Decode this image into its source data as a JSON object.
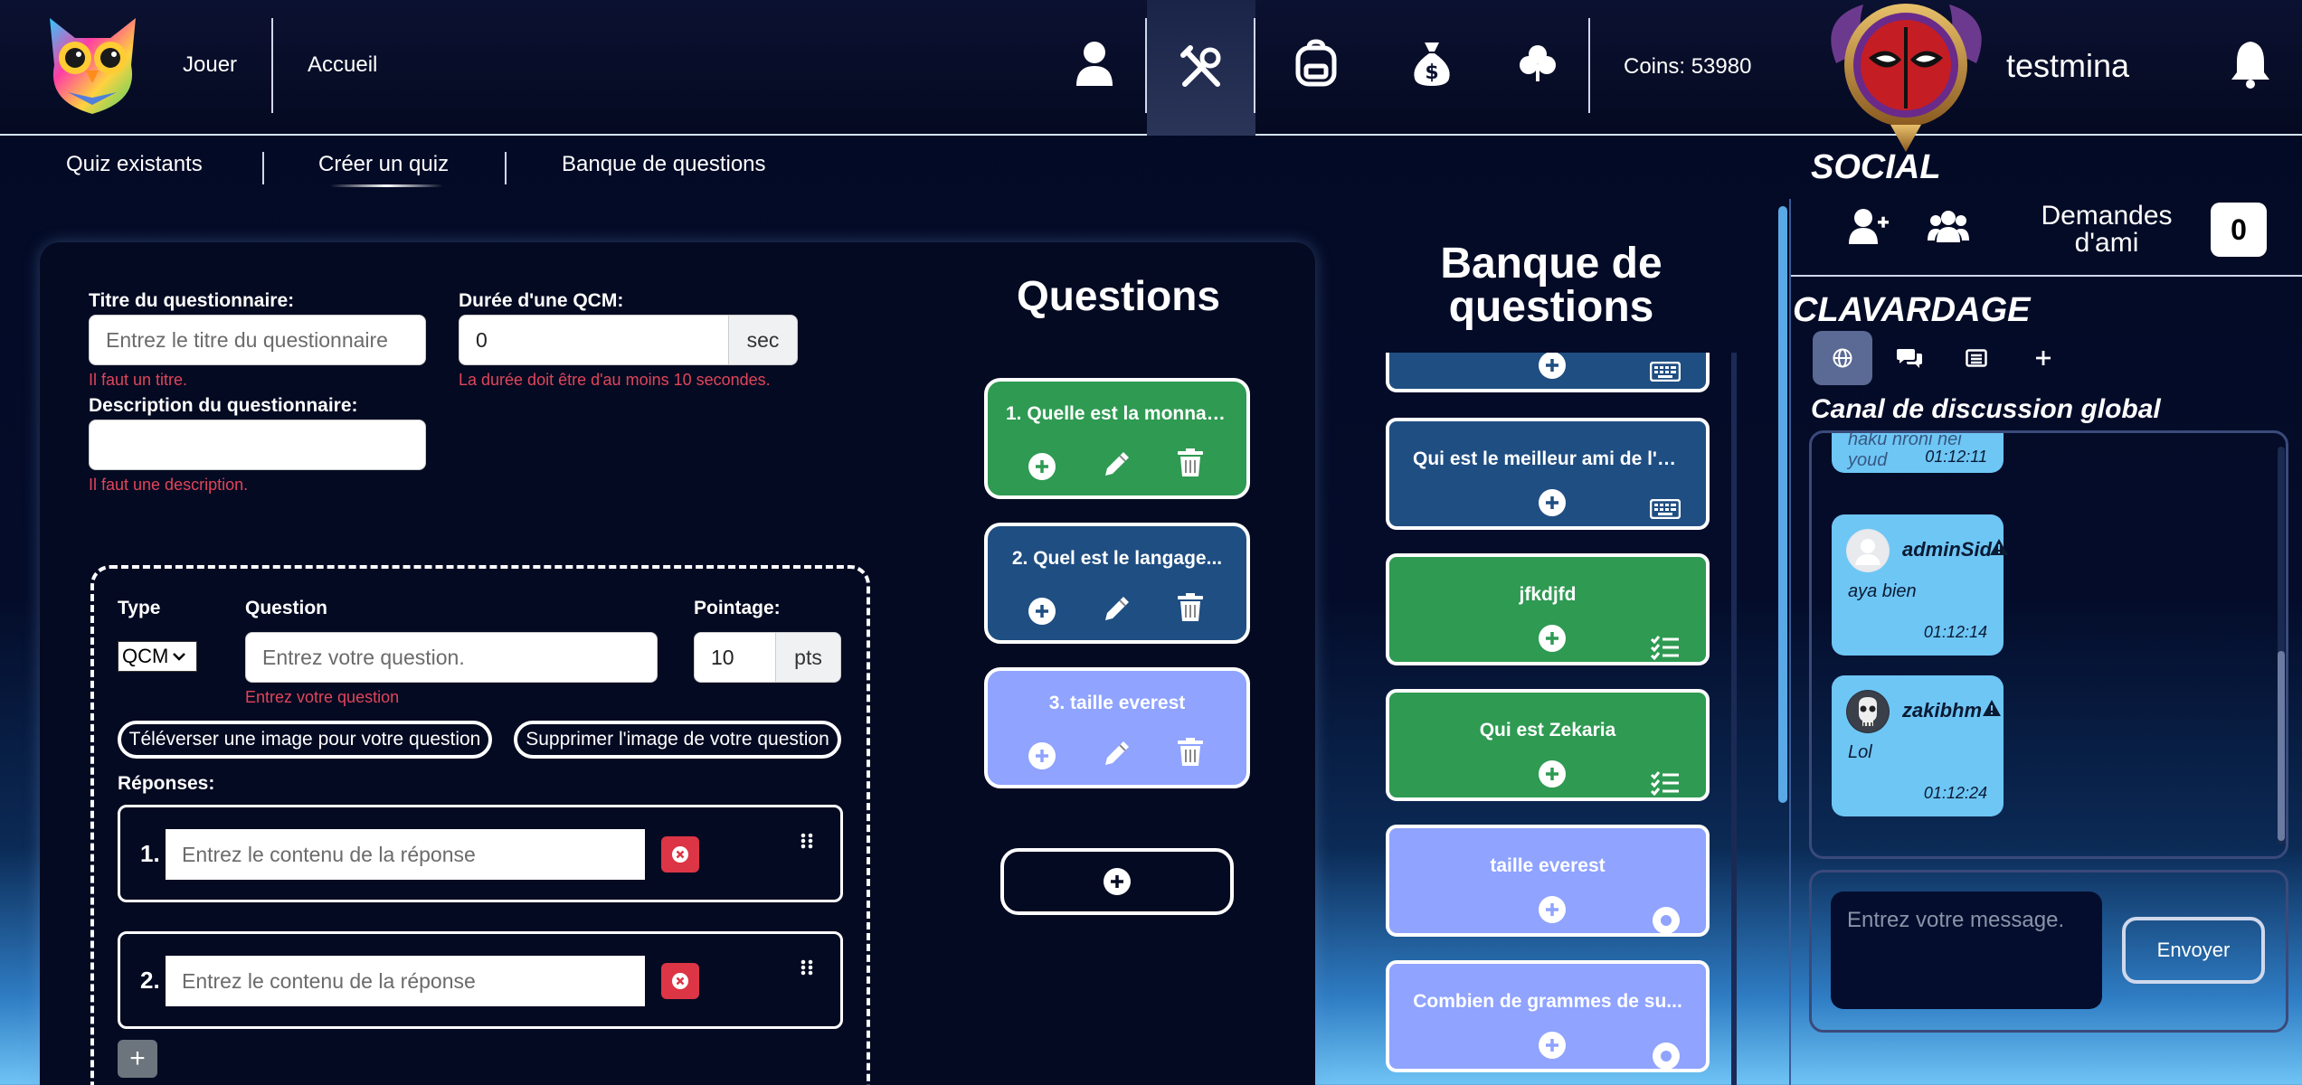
{
  "header": {
    "nav": {
      "play": "Jouer",
      "home": "Accueil"
    },
    "icons": [
      "user-icon",
      "tools-icon",
      "backpack-icon",
      "money-bag-icon",
      "clover-icon"
    ],
    "coins": "Coins: 53980",
    "username": "testmina"
  },
  "subnav": {
    "tabs": [
      "Quiz existants",
      "Créer un quiz",
      "Banque de questions"
    ],
    "active": "Créer un quiz"
  },
  "form": {
    "title_label": "Titre du questionnaire:",
    "title_placeholder": "Entrez le titre du questionnaire",
    "title_error": "Il faut un titre.",
    "duration_label": "Durée d'une QCM:",
    "duration_value": "0",
    "duration_suffix": "sec",
    "duration_error": "La durée doit être d'au moins 10 secondes.",
    "description_label": "Description du questionnaire:",
    "description_placeholder": "",
    "description_error": "Il faut une description.",
    "question_editor": {
      "type_label": "Type",
      "type_value": "QCM",
      "question_label": "Question",
      "question_placeholder": "Entrez votre question.",
      "question_error": "Entrez votre question",
      "points_label": "Pointage:",
      "points_value": "10",
      "points_suffix": "pts",
      "upload_image": "Téléverser une image pour votre question",
      "remove_image": "Supprimer l'image de votre question",
      "answers_label": "Réponses:",
      "answers": [
        {
          "number": "1.",
          "placeholder": "Entrez le contenu de la réponse"
        },
        {
          "number": "2.",
          "placeholder": "Entrez le contenu de la réponse"
        }
      ],
      "add_answer": "+"
    }
  },
  "questions": {
    "title": "Questions",
    "items": [
      {
        "label": "1. Quelle est la monnaie...",
        "color": "#2e9a52"
      },
      {
        "label": "2. Quel est le langage...",
        "color": "#1f4e82"
      },
      {
        "label": "3. taille everest",
        "color": "#8fa3ff"
      }
    ]
  },
  "bank": {
    "title": "Banque de questions",
    "items": [
      {
        "label": "",
        "color": "#1f4e82",
        "kind": "keyboard-icon"
      },
      {
        "label": "Qui est le meilleur ami de l'h...",
        "color": "#1f4e82",
        "kind": "keyboard-icon"
      },
      {
        "label": "jfkdjfd",
        "color": "#2e9a52",
        "kind": "checklist-icon"
      },
      {
        "label": "Qui est Zekaria",
        "color": "#2e9a52",
        "kind": "checklist-icon"
      },
      {
        "label": "taille everest",
        "color": "#8fa3ff",
        "kind": "target-icon"
      },
      {
        "label": "Combien de grammes de su...",
        "color": "#8fa3ff",
        "kind": "target-icon"
      }
    ]
  },
  "social": {
    "title": "SOCIAL",
    "friend_requests_label": "Demandes d'ami",
    "friend_requests_count": "0",
    "chat_title": "CLAVARDAGE",
    "channel_title": "Canal de discussion global",
    "messages": [
      {
        "user": "",
        "text": "haku nroni nei youd",
        "time": "01:12:11"
      },
      {
        "user": "adminSid",
        "text": "aya bien",
        "time": "01:12:14"
      },
      {
        "user": "zakibhm",
        "text": "Lol",
        "time": "01:12:24"
      }
    ],
    "message_placeholder": "Entrez votre message.",
    "send_label": "Envoyer"
  }
}
